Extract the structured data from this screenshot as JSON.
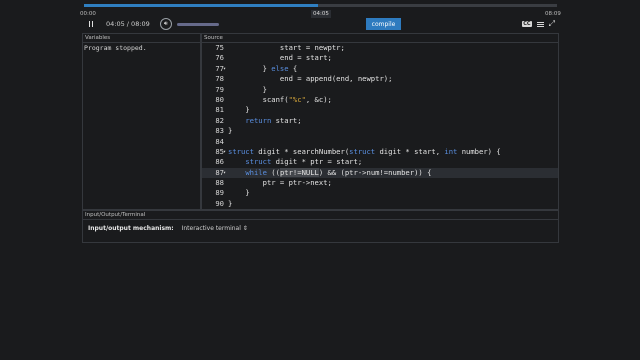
{
  "player": {
    "progress_pct": 49.4,
    "time_start": "00:00",
    "time_end": "08:09",
    "time_marker": "04:05",
    "time_readout": "04:05 / 08:09",
    "compile_label": "compile",
    "cc_label": "CC"
  },
  "variables": {
    "title": "Variables",
    "status": "Program stopped."
  },
  "source": {
    "title": "Source",
    "active_line": 87,
    "lines": [
      {
        "n": "75",
        "text": "            start = newptr;"
      },
      {
        "n": "76",
        "text": "            end = start;"
      },
      {
        "n": "77",
        "text": "        } else {",
        "fold": true
      },
      {
        "n": "78",
        "text": "            end = append(end, newptr);"
      },
      {
        "n": "79",
        "text": "        }"
      },
      {
        "n": "80",
        "text": "        scanf(\"%c\", &c);"
      },
      {
        "n": "81",
        "text": "    }"
      },
      {
        "n": "82",
        "text": "    return start;"
      },
      {
        "n": "83",
        "text": "}"
      },
      {
        "n": "84",
        "text": ""
      },
      {
        "n": "85",
        "text": "struct digit * searchNumber(struct digit * start, int number) {",
        "fold": true
      },
      {
        "n": "86",
        "text": "    struct digit * ptr = start;"
      },
      {
        "n": "87",
        "text": "    while ((ptr!=NULL) && (ptr->num!=number)) {",
        "fold": true
      },
      {
        "n": "88",
        "text": "        ptr = ptr->next;"
      },
      {
        "n": "89",
        "text": "    }"
      },
      {
        "n": "90",
        "text": "}"
      }
    ]
  },
  "io": {
    "title": "Input/Output/Terminal",
    "mechanism_label": "Input/output mechanism:",
    "mechanism_value": "Interactive terminal ⇕"
  }
}
